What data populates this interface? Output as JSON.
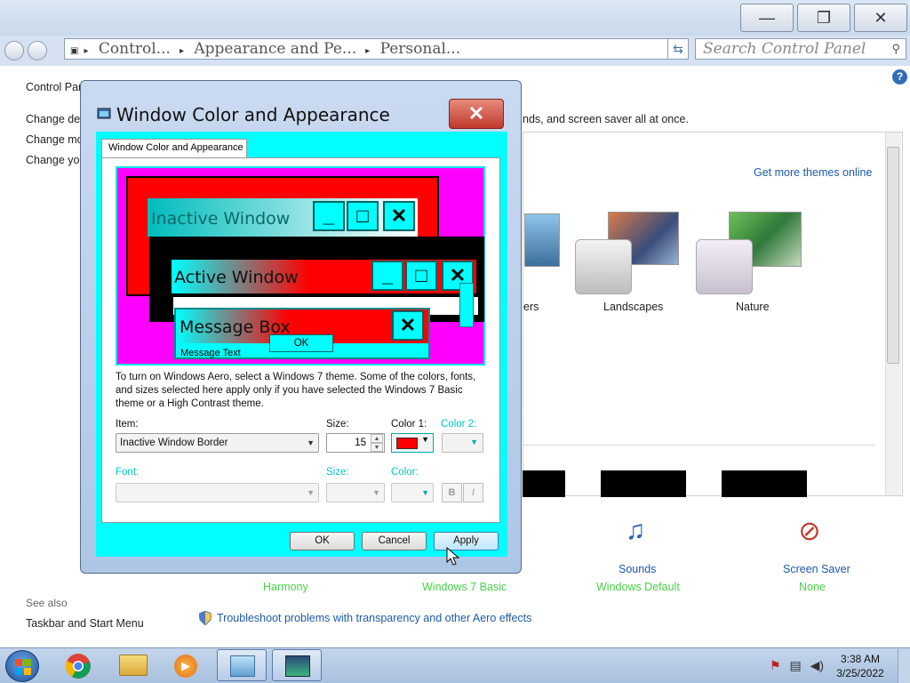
{
  "explorer": {
    "address_segments": [
      "Control...",
      "Appearance and Pe...",
      "Personal..."
    ],
    "search_placeholder": "Search Control Panel",
    "left_items": [
      "Control Pan",
      "Change des",
      "Change mo",
      "Change you"
    ],
    "intro_text": "nds, and screen saver all at once.",
    "get_more_link": "Get more themes online",
    "themes": [
      {
        "label": "ers"
      },
      {
        "label": "Landscapes"
      },
      {
        "label": "Nature"
      }
    ],
    "bottom": {
      "sounds_label": "Sounds",
      "sounds_value": "Windows Default",
      "saver_label": "Screen Saver",
      "saver_value": "None",
      "harmony": "Harmony",
      "basic": "Windows 7 Basic"
    },
    "see_also": "See also",
    "taskbar_link": "Taskbar and Start Menu",
    "trouble_link": "Troubleshoot problems with transparency and other Aero effects"
  },
  "dialog": {
    "title": "Window Color and Appearance",
    "tab_label": "Window Color and Appearance",
    "preview": {
      "inactive": "Inactive Window",
      "active": "Active Window",
      "message_box": "Message Box",
      "ok": "OK",
      "message_text": "Message Text",
      "minimize_glyph": "_",
      "maximize_glyph": "□",
      "close_glyph": "✕"
    },
    "description": "To turn on Windows Aero, select a Windows 7 theme.  Some of the colors, fonts, and sizes selected here apply only if you have selected the Windows 7 Basic theme or a High Contrast theme.",
    "item_label": "Item:",
    "item_value": "Inactive Window Border",
    "size_label": "Size:",
    "size_value": "15",
    "color1_label": "Color 1:",
    "color2_label": "Color 2:",
    "color1_value": "#ff0000",
    "font_label": "Font:",
    "font_size_label": "Size:",
    "font_color_label": "Color:",
    "bold_label": "B",
    "italic_label": "I",
    "ok_button": "OK",
    "cancel_button": "Cancel",
    "apply_button": "Apply"
  },
  "taskbar": {
    "time": "3:38 AM",
    "date": "3/25/2022"
  },
  "colors": {
    "dialog_body": "#00ffff",
    "preview_bg": "#ff00ff",
    "link": "#1e5aa6",
    "green_text": "#4ad04a"
  }
}
